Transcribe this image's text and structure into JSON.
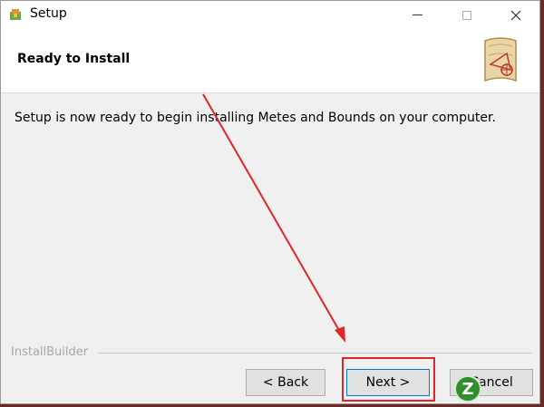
{
  "window": {
    "title": "Setup",
    "icon": "installer-icon"
  },
  "header": {
    "title": "Ready to Install",
    "logo": "map-scroll-logo"
  },
  "main": {
    "message": "Setup is now ready to begin installing Metes and Bounds on your computer."
  },
  "footer": {
    "brand": "InstallBuilder"
  },
  "buttons": {
    "back": "< Back",
    "next": "Next >",
    "cancel": "Cancel"
  },
  "annotation": {
    "color": "#e0262b"
  },
  "watermark": {
    "letter": "Z"
  }
}
